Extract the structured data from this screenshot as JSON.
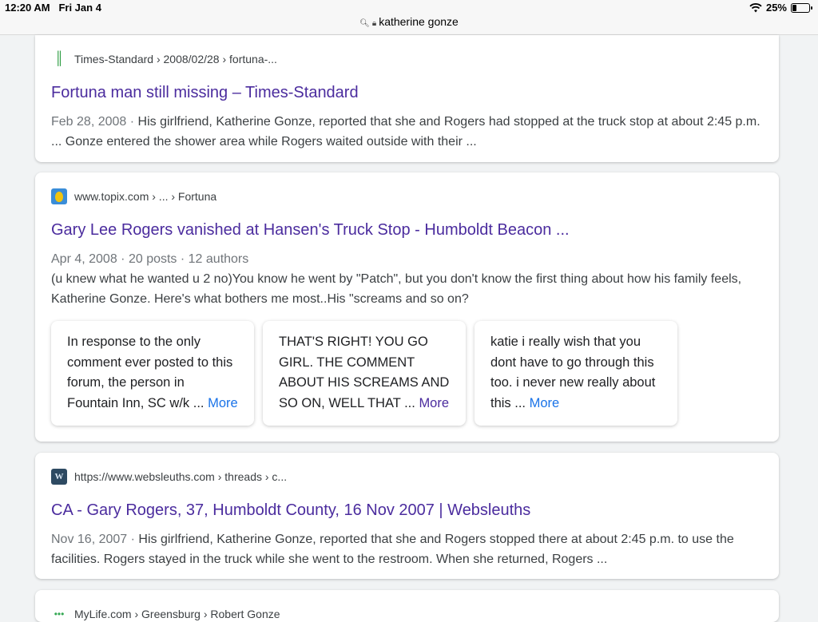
{
  "status": {
    "time": "12:20 AM",
    "date": "Fri Jan 4",
    "battery": "25%",
    "battery_level": 0.25
  },
  "url": {
    "text": "katherine gonze"
  },
  "results": [
    {
      "source": "Times-Standard › 2008/02/28 › fortuna-...",
      "favicon": "times-standard-icon",
      "title": "Fortuna man still missing – Times-Standard",
      "date": "Feb 28, 2008",
      "snippet": "His girlfriend, Katherine Gonze, reported that she and Rogers had stopped at the truck stop at about 2:45 p.m. ... Gonze entered the shower area while Rogers waited outside with their ..."
    },
    {
      "source": "www.topix.com › ... › Fortuna",
      "favicon": "topix-icon",
      "title": "Gary Lee Rogers vanished at Hansen's Truck Stop - Humboldt Beacon ...",
      "meta": "Apr 4, 2008 · 20 posts · 12 authors",
      "snippet": "(u knew what he wanted u 2 no)You know he went by \"Patch\", but you don't know the first thing about how his family feels, Katherine Gonze. Here's what bothers me most..His \"screams and so on?",
      "posts": [
        {
          "text": "In response to the only comment ever posted to this forum, the person in Fountain Inn, SC w/k ...",
          "more": "More"
        },
        {
          "text": "THAT'S RIGHT! YOU GO GIRL. THE COMMENT ABOUT HIS SCREAMS AND SO ON, WELL THAT ...",
          "more": "More"
        },
        {
          "text": "katie i really wish that you dont have to go through this too. i never new really about this ...",
          "more": "More"
        }
      ]
    },
    {
      "source": "https://www.websleuths.com › threads › c...",
      "favicon": "websleuths-icon",
      "title": "CA - Gary Rogers, 37, Humboldt County, 16 Nov 2007 | Websleuths",
      "date": "Nov 16, 2007",
      "snippet": "His girlfriend, Katherine Gonze, reported that she and Rogers stopped there at about 2:45 p.m. to use the facilities. Rogers stayed in the truck while she went to the restroom. When she returned, Rogers ..."
    },
    {
      "source": "MyLife.com › Greensburg › Robert Gonze",
      "favicon": "mylife-icon"
    }
  ]
}
